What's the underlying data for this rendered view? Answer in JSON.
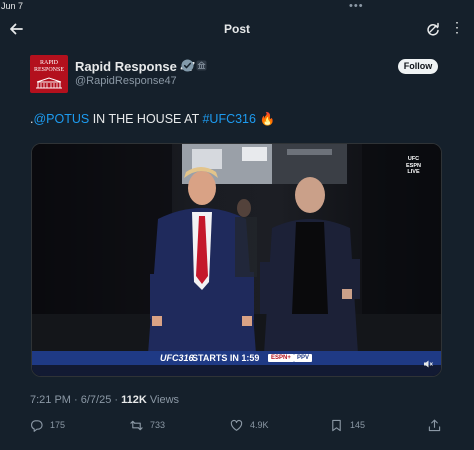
{
  "status_bar": {
    "date": "Jun 7",
    "dots": "•••"
  },
  "header": {
    "title": "Post"
  },
  "author": {
    "name": "Rapid Response 47",
    "handle": "@RapidResponse47",
    "avatar_text_line1": "RAPID",
    "avatar_text_line2": "RESPONSE"
  },
  "follow_label": "Follow",
  "tweet": {
    "prefix": ".",
    "mention": "@POTUS",
    "middle": " IN THE HOUSE AT ",
    "hashtag": "#UFC316",
    "emoji": "🔥"
  },
  "media": {
    "bug_line1": "UFC",
    "bug_line2": "ESPN",
    "bug_line3": "LIVE",
    "scorebar_logo": "UFC316",
    "scorebar_text": "STARTS IN 1:59",
    "espn_badge": "ESPN+",
    "ppv_badge": "PPV"
  },
  "meta": {
    "time": "7:21 PM",
    "separator": " · ",
    "date": "6/7/25",
    "views_count": "112K",
    "views_label": " Views"
  },
  "actions": {
    "replies": "175",
    "reposts": "733",
    "likes": "4.9K",
    "bookmarks": "145"
  },
  "colors": {
    "background": "#15202b",
    "accent": "#1d9bf0",
    "secondary_text": "#8b98a5",
    "avatar_red": "#b3101d"
  }
}
